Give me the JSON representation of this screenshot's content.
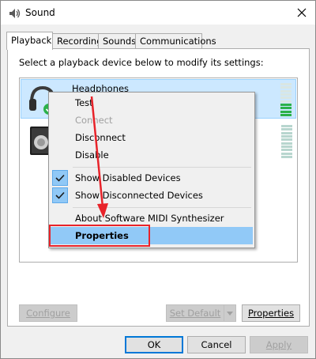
{
  "window": {
    "title": "Sound"
  },
  "tabs": [
    {
      "label": "Playback",
      "active": true
    },
    {
      "label": "Recording",
      "active": false
    },
    {
      "label": "Sounds",
      "active": false
    },
    {
      "label": "Communications",
      "active": false
    }
  ],
  "panel": {
    "instruction": "Select a playback device below to modify its settings:",
    "devices": [
      {
        "name": "Headphones",
        "icon": "headphones-icon",
        "selected": true,
        "default": true
      },
      {
        "name": "",
        "icon": "speaker-icon",
        "selected": false,
        "default": false
      }
    ]
  },
  "context_menu": {
    "items": [
      {
        "label": "Test",
        "enabled": true
      },
      {
        "label": "Connect",
        "enabled": false
      },
      {
        "label": "Disconnect",
        "enabled": true
      },
      {
        "label": "Disable",
        "enabled": true
      },
      {
        "label": "Show Disabled Devices",
        "checked": true
      },
      {
        "label": "Show Disconnected Devices",
        "checked": true
      },
      {
        "label": "About Software MIDI Synthesizer",
        "enabled": true
      },
      {
        "label": "Properties",
        "highlighted": true
      }
    ]
  },
  "buttons": {
    "configure": "Configure",
    "set_default": "Set Default",
    "properties": "Properties",
    "ok": "OK",
    "cancel": "Cancel",
    "apply": "Apply"
  },
  "colors": {
    "annotation": "#e8232a",
    "selection": "#cce8ff",
    "menu_highlight": "#91c9f7",
    "level_active": "#2bb14a"
  }
}
